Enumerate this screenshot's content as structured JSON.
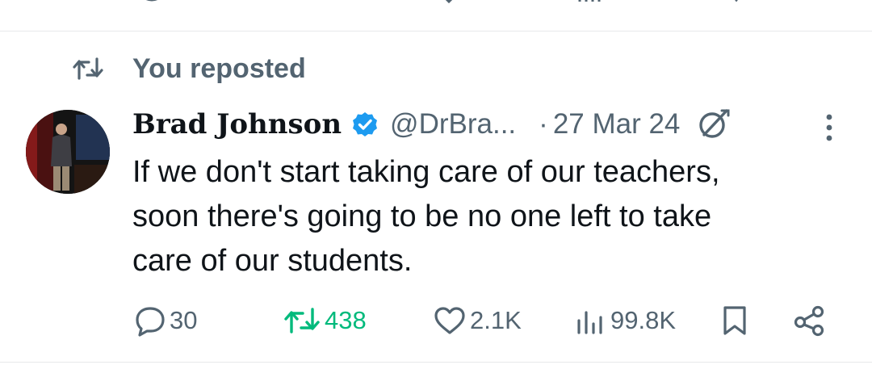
{
  "feed": {
    "repost_label": "You reposted",
    "post": {
      "author_name": "Brad Johnson",
      "verified": true,
      "handle": "@DrBra...",
      "separator": "·",
      "date": "27 Mar 24",
      "text": "If we don't start taking care of our teachers,\nsoon there's going to be no one left to take\ncare of our students.",
      "actions": {
        "replies": "30",
        "reposts": "438",
        "likes": "2.1K",
        "views": "99.8K"
      }
    }
  },
  "colors": {
    "text_primary": "#0f1419",
    "text_secondary": "#536471",
    "repost_active": "#00ba7c",
    "verified_blue": "#1d9bf0",
    "divider": "#e7e9ea"
  },
  "icons": [
    "repost-icon",
    "verified-badge-icon",
    "grok-icon",
    "more-icon",
    "reply-icon",
    "like-icon",
    "views-icon",
    "bookmark-icon",
    "share-icon"
  ]
}
